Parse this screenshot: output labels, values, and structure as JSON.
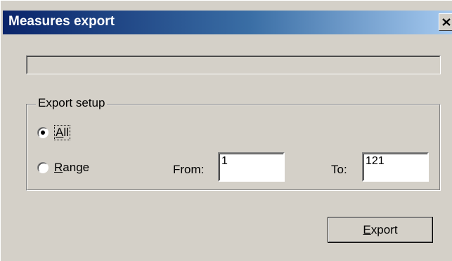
{
  "window": {
    "title": "Measures export"
  },
  "progress": {
    "value": 0
  },
  "export_setup": {
    "group_label": "Export setup",
    "options": [
      {
        "label": "All",
        "selected": true
      },
      {
        "label": "Range",
        "selected": false
      }
    ],
    "from_label": "From:",
    "from_value": "1",
    "to_label": "To:",
    "to_value": "121"
  },
  "actions": {
    "export_label": "Export"
  },
  "colors": {
    "titlebar_start": "#0a246a",
    "titlebar_end": "#a6caf0",
    "face": "#d4d0c8"
  },
  "icons": {
    "close": "close-icon"
  }
}
